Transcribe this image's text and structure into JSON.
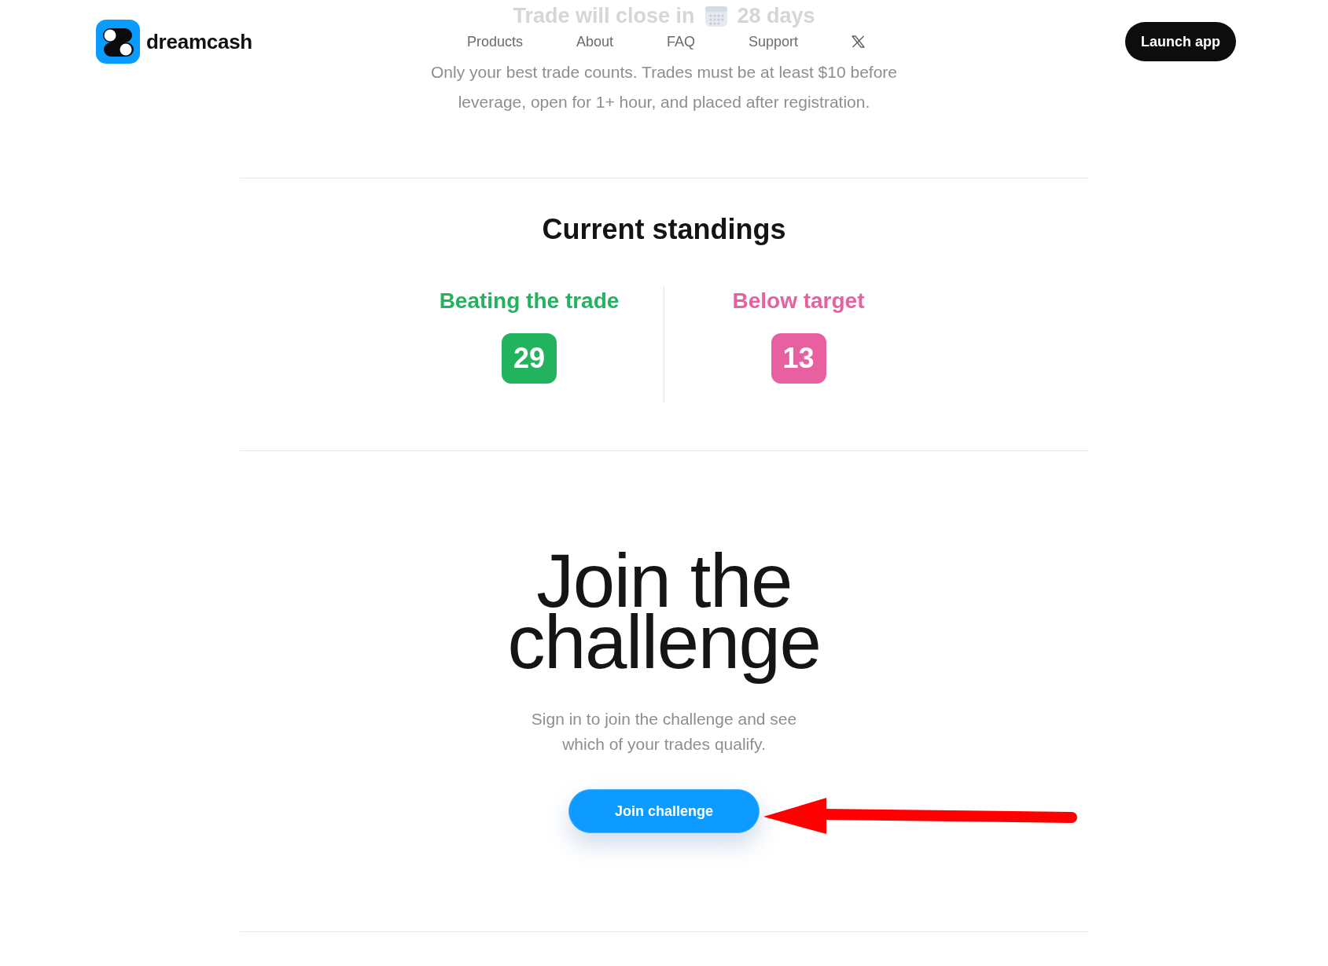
{
  "header": {
    "brand": "dreamcash",
    "nav": [
      {
        "label": "Products"
      },
      {
        "label": "About"
      },
      {
        "label": "FAQ"
      },
      {
        "label": "Support"
      }
    ],
    "launch_button": "Launch app"
  },
  "countdown": {
    "label": "Trade will close in",
    "value": "28 days"
  },
  "rules_text": "Only your best trade counts. Trades must be at least $10 before leverage, open for 1+ hour, and placed after registration.",
  "standings": {
    "title": "Current standings",
    "groups": [
      {
        "label": "Beating the trade",
        "count": "29",
        "color": "#22b35e"
      },
      {
        "label": "Below target",
        "count": "13",
        "color": "#e8609f"
      }
    ]
  },
  "cta": {
    "title": "Join the challenge",
    "subtitle": "Sign in to join the challenge and see which of your trades qualify.",
    "button": "Join challenge",
    "annotation": {
      "kind": "arrow"
    }
  }
}
